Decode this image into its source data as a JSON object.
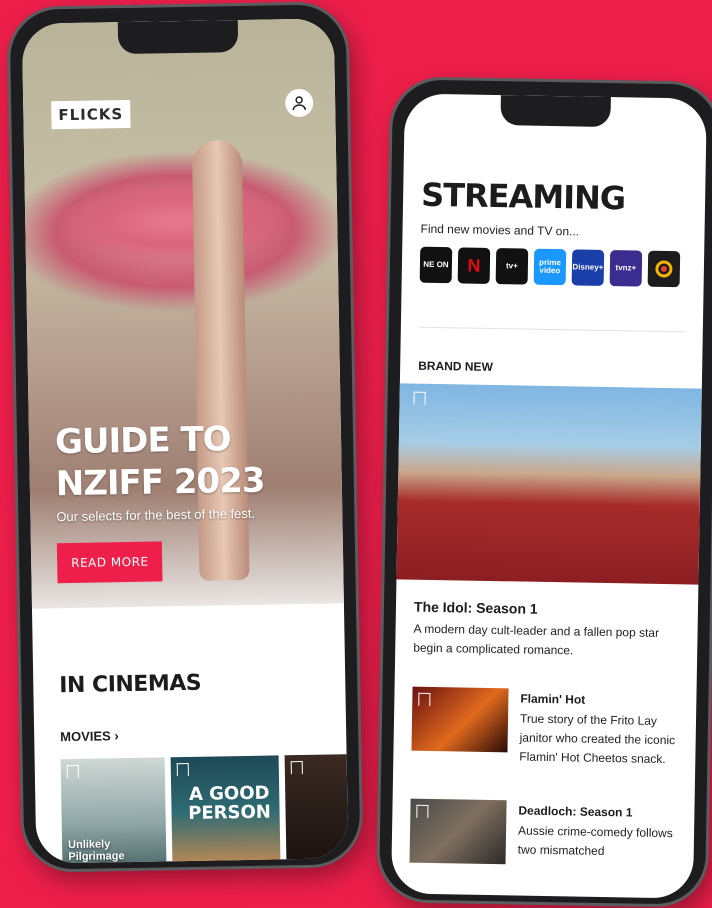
{
  "phone_left": {
    "brand": "FLICKS",
    "hero": {
      "title_line1": "GUIDE TO",
      "title_line2": "NZIFF 2023",
      "subtitle": "Our selects for the best of the fest.",
      "cta": "READ MORE"
    },
    "section_title": "IN CINEMAS",
    "movies_link": "MOVIES",
    "posters": [
      {
        "title": "Unlikely Pilgrimage"
      },
      {
        "title": "A GOOD PERSON"
      }
    ]
  },
  "phone_right": {
    "title": "STREAMING",
    "subtitle": "Find new movies and TV on...",
    "services": [
      {
        "label": "NE ON",
        "icon": "neon-logo",
        "color": "#111111"
      },
      {
        "label": "N",
        "icon": "netflix-logo",
        "color": "#111111"
      },
      {
        "label": "tv+",
        "icon": "apple-tv-logo",
        "color": "#111111"
      },
      {
        "label": "prime video",
        "icon": "prime-video-logo",
        "color": "#1a98ff"
      },
      {
        "label": "Disney+",
        "icon": "disney-plus-logo",
        "color": "#1a3fa8"
      },
      {
        "label": "tvnz+",
        "icon": "tvnz-logo",
        "color": "#3a2d8f"
      },
      {
        "label": "",
        "icon": "google-play-logo",
        "color": "#1c1c1c"
      }
    ],
    "section_label": "BRAND NEW",
    "feature": {
      "title": "The Idol: Season 1",
      "description": "A modern day cult-leader and a fallen pop star begin a complicated romance."
    },
    "items": [
      {
        "title": "Flamin' Hot",
        "description": "True story of the Frito Lay janitor who created the iconic Flamin' Hot Cheetos snack."
      },
      {
        "title": "Deadloch: Season 1",
        "description": "Aussie crime-comedy follows two mismatched"
      }
    ]
  },
  "colors": {
    "accent": "#ee1f4b"
  }
}
